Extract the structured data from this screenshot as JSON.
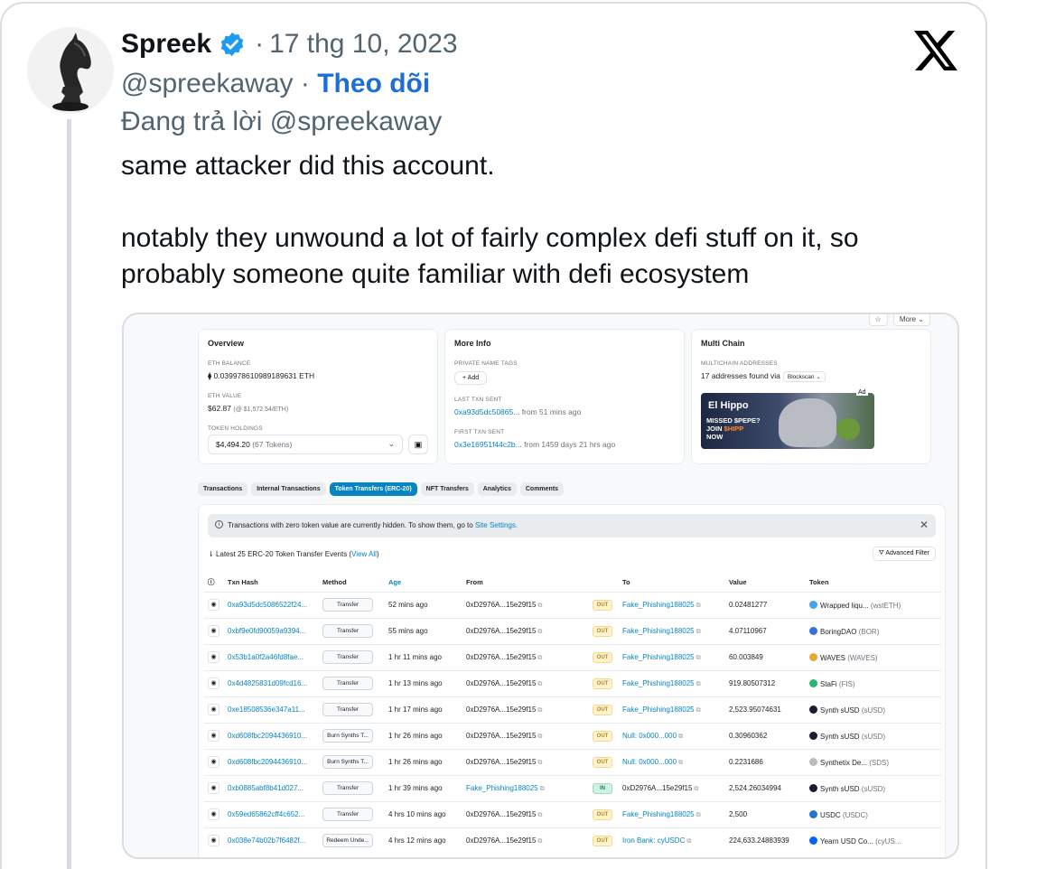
{
  "tweet": {
    "author_name": "Spreek",
    "date": "17 thg 10, 2023",
    "handle": "@spreekaway",
    "separator": "·",
    "follow_label": "Theo dõi",
    "replying_to": "Đang trả lời @spreekaway",
    "text_line1": "same attacker did this account.",
    "text_line2": "notably they unwound a lot of fairly complex defi stuff on it, so",
    "text_line3": "probably someone quite familiar with defi ecosystem",
    "icons": {
      "avatar": "chess-knight-avatar",
      "verified": "verified-badge-icon",
      "platform": "x-logo-icon"
    }
  },
  "explorer": {
    "top_buttons": {
      "star": "☆",
      "more": "More ⌄"
    },
    "overview": {
      "title": "Overview",
      "eth_balance_label": "ETH BALANCE",
      "eth_balance": "⧫ 0.039978610989189631 ETH",
      "eth_value_label": "ETH VALUE",
      "eth_value": "$62.87",
      "eth_value_sub": "(@ $1,572.54/ETH)",
      "token_holdings_label": "TOKEN HOLDINGS",
      "token_holdings": "$4,494.20",
      "token_holdings_sub": "(67 Tokens)"
    },
    "more_info": {
      "title": "More Info",
      "private_tags_label": "PRIVATE NAME TAGS",
      "add_label": "+ Add",
      "last_txn_label": "LAST TXN SENT",
      "last_txn_hash": "0xa93d5dc50865...",
      "last_txn_time": "from 51 mins ago",
      "first_txn_label": "FIRST TXN SENT",
      "first_txn_hash": "0x3e16951f44c2b...",
      "first_txn_time": "from 1459 days 21 hrs ago"
    },
    "multi_chain": {
      "title": "Multi Chain",
      "addresses_label": "MULTICHAIN ADDRESSES",
      "addresses_text": "17 addresses found via",
      "via_button": "Blockscan ⌄",
      "ad_tag": "Ad",
      "ad_title": "El Hippo",
      "ad_line1": "MISSED $PEPE?",
      "ad_line2a": "JOIN",
      "ad_line2b": "$HIPP",
      "ad_line3": "NOW"
    },
    "tabs": [
      "Transactions",
      "Internal Transactions",
      "Token Transfers (ERC-20)",
      "NFT Transfers",
      "Analytics",
      "Comments"
    ],
    "notice": "Transactions with zero token value are currently hidden. To show them, go to",
    "notice_link": "Site Settings.",
    "summary": "Latest 25 ERC-20 Token Transfer Events (",
    "summary_link": "View All",
    "summary_end": ")",
    "advanced_filter": "Advanced Filter",
    "columns": [
      "Txn Hash",
      "Method",
      "Age",
      "From",
      "To",
      "Value",
      "Token"
    ],
    "rows": [
      {
        "hash": "0xa93d5dc5086522f24...",
        "method": "Transfer",
        "age": "52 mins ago",
        "from": "0xD2976A...15e29f15",
        "dir": "OUT",
        "to": "Fake_Phishing188025",
        "value": "0.02481277",
        "token": "Wrapped liqu...",
        "symbol": "(wstETH)",
        "color": "#4aa3e6"
      },
      {
        "hash": "0xbf9e0fd90059a9394...",
        "method": "Transfer",
        "age": "55 mins ago",
        "from": "0xD2976A...15e29f15",
        "dir": "OUT",
        "to": "Fake_Phishing188025",
        "value": "4.07110967",
        "token": "BoringDAO",
        "symbol": "(BOR)",
        "color": "#3b6fd8"
      },
      {
        "hash": "0x53b1a0f2a46fd8fae...",
        "method": "Transfer",
        "age": "1 hr 11 mins ago",
        "from": "0xD2976A...15e29f15",
        "dir": "OUT",
        "to": "Fake_Phishing188025",
        "value": "60.003849",
        "token": "WAVES",
        "symbol": "(WAVES)",
        "color": "#e5a93a"
      },
      {
        "hash": "0x4d4825831d09fcd16...",
        "method": "Transfer",
        "age": "1 hr 13 mins ago",
        "from": "0xD2976A...15e29f15",
        "dir": "OUT",
        "to": "Fake_Phishing188025",
        "value": "919.80507312",
        "token": "StaFi",
        "symbol": "(FIS)",
        "color": "#2bb673"
      },
      {
        "hash": "0xe18508536e347a11...",
        "method": "Transfer",
        "age": "1 hr 17 mins ago",
        "from": "0xD2976A...15e29f15",
        "dir": "OUT",
        "to": "Fake_Phishing188025",
        "value": "2,523.95074631",
        "token": "Synth sUSD",
        "symbol": "(sUSD)",
        "color": "#1e1a31"
      },
      {
        "hash": "0xd608fbc2094436910...",
        "method": "Burn Synths T...",
        "age": "1 hr 26 mins ago",
        "from": "0xD2976A...15e29f15",
        "dir": "OUT",
        "to": "Null: 0x000...000",
        "value": "0.30960362",
        "token": "Synth sUSD",
        "symbol": "(sUSD)",
        "color": "#1e1a31"
      },
      {
        "hash": "0xd608fbc2094436910...",
        "method": "Burn Synths T...",
        "age": "1 hr 26 mins ago",
        "from": "0xD2976A...15e29f15",
        "dir": "OUT",
        "to": "Null: 0x000...000",
        "value": "0.2231686",
        "token": "Synthetix De...",
        "symbol": "(SDS)",
        "color": "#bbbbbb"
      },
      {
        "hash": "0xb0885abf8b41d027...",
        "method": "Transfer",
        "age": "1 hr 39 mins ago",
        "from": "Fake_Phishing188025",
        "dir": "IN",
        "to": "0xD2976A...15e29f15",
        "value": "2,524.26034994",
        "token": "Synth sUSD",
        "symbol": "(sUSD)",
        "color": "#1e1a31"
      },
      {
        "hash": "0x59ed65862cff4c652...",
        "method": "Transfer",
        "age": "4 hrs 10 mins ago",
        "from": "0xD2976A...15e29f15",
        "dir": "OUT",
        "to": "Fake_Phishing188025",
        "value": "2,500",
        "token": "USDC",
        "symbol": "(USDC)",
        "color": "#2775ca"
      },
      {
        "hash": "0x038e74b02b7f6482f...",
        "method": "Redeem Unde...",
        "age": "4 hrs 12 mins ago",
        "from": "0xD2976A...15e29f15",
        "dir": "OUT",
        "to": "Iron Bank: cyUSDC",
        "value": "224,633.24883939",
        "token": "Yearn USD Co...",
        "symbol": "(cyUS...",
        "color": "#0b63f6"
      }
    ]
  }
}
